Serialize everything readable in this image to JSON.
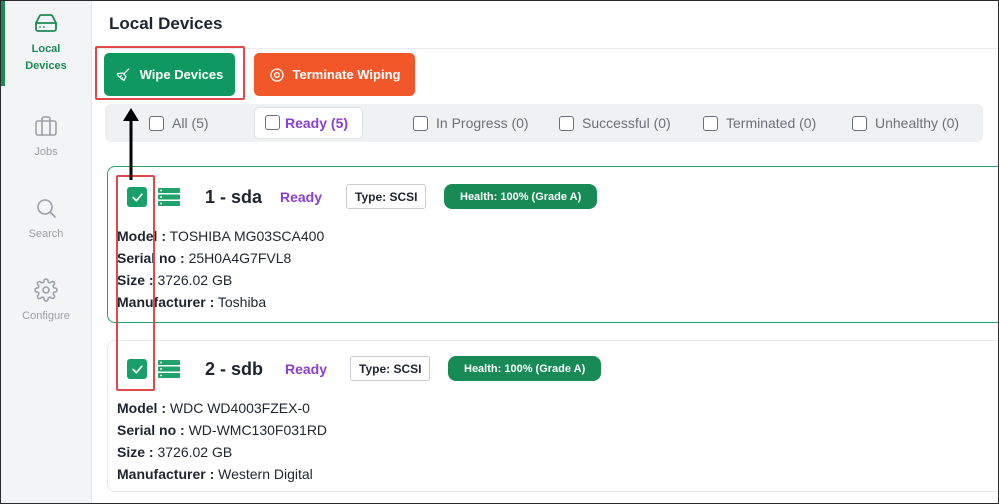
{
  "sidebar": {
    "items": [
      {
        "label": "Local\nDevices",
        "icon": "hard-drive-icon",
        "active": true
      },
      {
        "label": "Jobs",
        "icon": "briefcase-icon",
        "active": false
      },
      {
        "label": "Search",
        "icon": "search-icon",
        "active": false
      },
      {
        "label": "Configure",
        "icon": "gear-icon",
        "active": false
      }
    ]
  },
  "header": {
    "title": "Local Devices"
  },
  "toolbar": {
    "wipe_label": "Wipe Devices",
    "terminate_label": "Terminate Wiping"
  },
  "filters": [
    {
      "label": "All (5)",
      "selected": false
    },
    {
      "label": "Ready (5)",
      "selected": true
    },
    {
      "label": "In Progress (0)",
      "selected": false
    },
    {
      "label": "Successful (0)",
      "selected": false
    },
    {
      "label": "Terminated (0)",
      "selected": false
    },
    {
      "label": "Unhealthy (0)",
      "selected": false
    }
  ],
  "devices": [
    {
      "name": "1 - sda",
      "status": "Ready",
      "type": "Type: SCSI",
      "health": "Health: 100% (Grade A)",
      "model_label": "Model :",
      "model": "TOSHIBA MG03SCA400",
      "serial_label": "Serial no :",
      "serial": "25H0A4G7FVL8",
      "size_label": "Size :",
      "size": "3726.02 GB",
      "manufacturer_label": "Manufacturer :",
      "manufacturer": "Toshiba",
      "checked": true
    },
    {
      "name": "2 - sdb",
      "status": "Ready",
      "type": "Type: SCSI",
      "health": "Health: 100% (Grade A)",
      "model_label": "Model :",
      "model": "WDC WD4003FZEX-0",
      "serial_label": "Serial no :",
      "serial": "WD-WMC130F031RD",
      "size_label": "Size :",
      "size": "3726.02 GB",
      "manufacturer_label": "Manufacturer :",
      "manufacturer": "Western Digital",
      "checked": true
    }
  ],
  "colors": {
    "accent": "#0f9960",
    "danger": "#f2572a",
    "status": "#8a3fd0",
    "highlight": "#e0494b"
  }
}
